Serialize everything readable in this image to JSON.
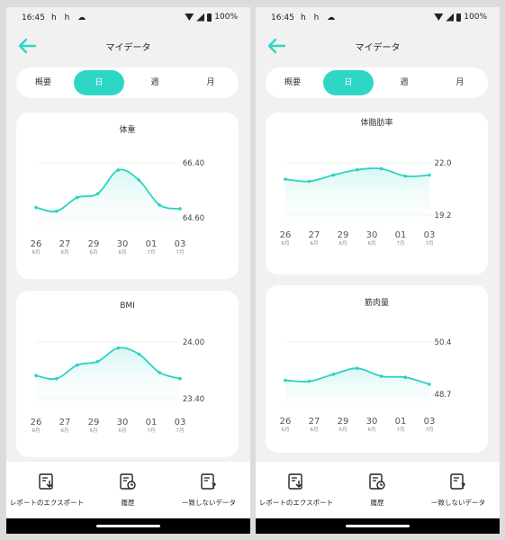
{
  "status": {
    "time": "16:45",
    "notif_icons": "h h ☁",
    "battery": "100%"
  },
  "app": {
    "title": "マイデータ"
  },
  "tabs": [
    {
      "label": "概要",
      "active": false
    },
    {
      "label": "日",
      "active": true
    },
    {
      "label": "週",
      "active": false
    },
    {
      "label": "月",
      "active": false
    }
  ],
  "bottom_actions": [
    {
      "label": "レポートのエクスポート",
      "icon": "export-report-icon"
    },
    {
      "label": "履歴",
      "icon": "history-icon"
    },
    {
      "label": "一致しないデータ",
      "icon": "unmatched-data-icon"
    }
  ],
  "colors": {
    "accent": "#2fd6c5",
    "line": "#29d3c2",
    "fill_top": "#d8f7f3"
  },
  "chart_data": [
    {
      "type": "area",
      "title": "体重",
      "x": [
        "26\n6月",
        "27\n6月",
        "29\n6月",
        "30\n6月",
        "01\n7月",
        "03\n7月"
      ],
      "x_day": [
        "26",
        "27",
        "29",
        "30",
        "01",
        "03"
      ],
      "x_month": [
        "6月",
        "6月",
        "6月",
        "6月",
        "7月",
        "7月"
      ],
      "y_ticks": [
        "66.40",
        "64.60"
      ],
      "ylim": [
        64.2,
        66.9
      ],
      "series": [
        {
          "values": [
            64.9,
            64.75,
            65.3,
            65.45,
            66.4,
            66.0,
            65.0,
            64.85
          ]
        }
      ]
    },
    {
      "type": "area",
      "title": "BMI",
      "x_day": [
        "26",
        "27",
        "29",
        "30",
        "01",
        "03"
      ],
      "x_month": [
        "6月",
        "6月",
        "6月",
        "6月",
        "7月",
        "7月"
      ],
      "y_ticks": [
        "24.00",
        "23.40"
      ],
      "ylim": [
        23.1,
        24.2
      ],
      "series": [
        {
          "values": [
            23.55,
            23.5,
            23.72,
            23.78,
            24.0,
            23.9,
            23.6,
            23.5
          ]
        }
      ]
    },
    {
      "type": "area",
      "title": "体脂肪率",
      "x_day": [
        "26",
        "27",
        "29",
        "30",
        "01",
        "03"
      ],
      "x_month": [
        "6月",
        "6月",
        "6月",
        "6月",
        "7月",
        "7月"
      ],
      "y_ticks": [
        "22.0",
        "19.2"
      ],
      "ylim": [
        17.5,
        23.5
      ],
      "series": [
        {
          "values": [
            21.0,
            20.8,
            21.4,
            21.9,
            22.0,
            21.3,
            21.4
          ]
        }
      ]
    },
    {
      "type": "area",
      "title": "筋肉量",
      "x_day": [
        "26",
        "27",
        "29",
        "30",
        "01",
        "03"
      ],
      "x_month": [
        "6月",
        "6月",
        "6月",
        "6月",
        "7月",
        "7月"
      ],
      "y_ticks": [
        "50.4",
        "48.7"
      ],
      "ylim": [
        47.9,
        51.5
      ],
      "series": [
        {
          "values": [
            49.0,
            48.95,
            49.3,
            49.6,
            49.2,
            49.15,
            48.8
          ]
        }
      ]
    }
  ]
}
